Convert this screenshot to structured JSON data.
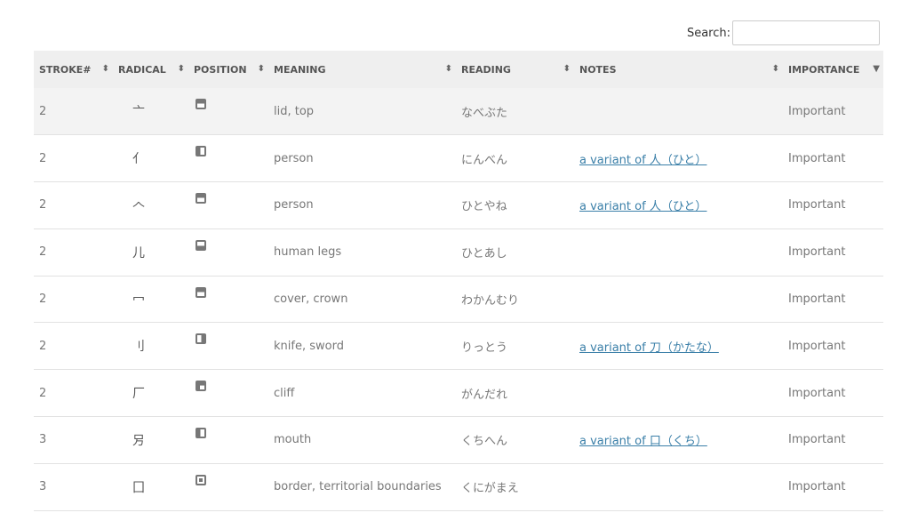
{
  "search": {
    "label": "Search:",
    "value": ""
  },
  "columns": [
    {
      "label": "STROKE#",
      "sort_icon": "sort-both-icon",
      "glyph": "⬍"
    },
    {
      "label": "RADICAL",
      "sort_icon": "sort-both-icon",
      "glyph": "⬍"
    },
    {
      "label": "POSITION",
      "sort_icon": "sort-both-icon",
      "glyph": "⬍"
    },
    {
      "label": "MEANING",
      "sort_icon": "sort-both-icon",
      "glyph": "⬍"
    },
    {
      "label": "READING",
      "sort_icon": "sort-both-icon",
      "glyph": "⬍"
    },
    {
      "label": "NOTES",
      "sort_icon": "sort-both-icon",
      "glyph": "⬍"
    },
    {
      "label": "IMPORTANCE",
      "sort_icon": "sort-desc-icon",
      "glyph": "▼"
    }
  ],
  "rows": [
    {
      "stroke": "2",
      "radical": "亠",
      "position": "top",
      "meaning": "lid, top",
      "reading": "なべぶた",
      "notes": "",
      "importance": "Important"
    },
    {
      "stroke": "2",
      "radical": "亻",
      "position": "left",
      "meaning": "person",
      "reading": "にんべん",
      "notes": "a variant of 人（ひと）",
      "importance": "Important"
    },
    {
      "stroke": "2",
      "radical": "𠆢",
      "position": "top",
      "meaning": "person",
      "reading": "ひとやね",
      "notes": "a variant of 人（ひと）",
      "importance": "Important"
    },
    {
      "stroke": "2",
      "radical": "儿",
      "position": "bottom",
      "meaning": "human legs",
      "reading": "ひとあし",
      "notes": "",
      "importance": "Important"
    },
    {
      "stroke": "2",
      "radical": "冖",
      "position": "top",
      "meaning": "cover, crown",
      "reading": "わかんむり",
      "notes": "",
      "importance": "Important"
    },
    {
      "stroke": "2",
      "radical": "刂",
      "position": "right",
      "meaning": "knife, sword",
      "reading": "りっとう",
      "notes": "a variant of 刀（かたな）",
      "importance": "Important"
    },
    {
      "stroke": "2",
      "radical": "厂",
      "position": "topleft",
      "meaning": "cliff",
      "reading": "がんだれ",
      "notes": "",
      "importance": "Important"
    },
    {
      "stroke": "3",
      "radical": "𠮠",
      "position": "left",
      "meaning": "mouth",
      "reading": "くちへん",
      "notes": "a variant of 口（くち）",
      "importance": "Important"
    },
    {
      "stroke": "3",
      "radical": "囗",
      "position": "enclose",
      "meaning": "border, territorial boundaries",
      "reading": "くにがまえ",
      "notes": "",
      "importance": "Important"
    }
  ]
}
